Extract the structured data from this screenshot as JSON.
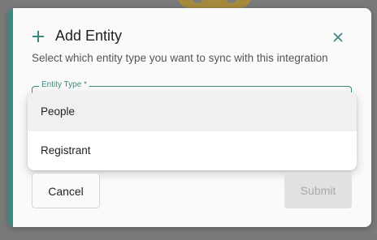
{
  "modal": {
    "title": "Add Entity",
    "subtitle": "Select which entity type you want to sync with this integration",
    "accent_color": "#3d8780"
  },
  "entity_type_field": {
    "label": "Entity Type *",
    "value": ""
  },
  "dropdown": {
    "options": [
      {
        "label": "People",
        "highlighted": true
      },
      {
        "label": "Registrant",
        "highlighted": false
      }
    ]
  },
  "actions": {
    "cancel_label": "Cancel",
    "submit_label": "Submit",
    "submit_disabled": true
  },
  "icons": {
    "add": "plus-icon",
    "close": "close-icon"
  }
}
